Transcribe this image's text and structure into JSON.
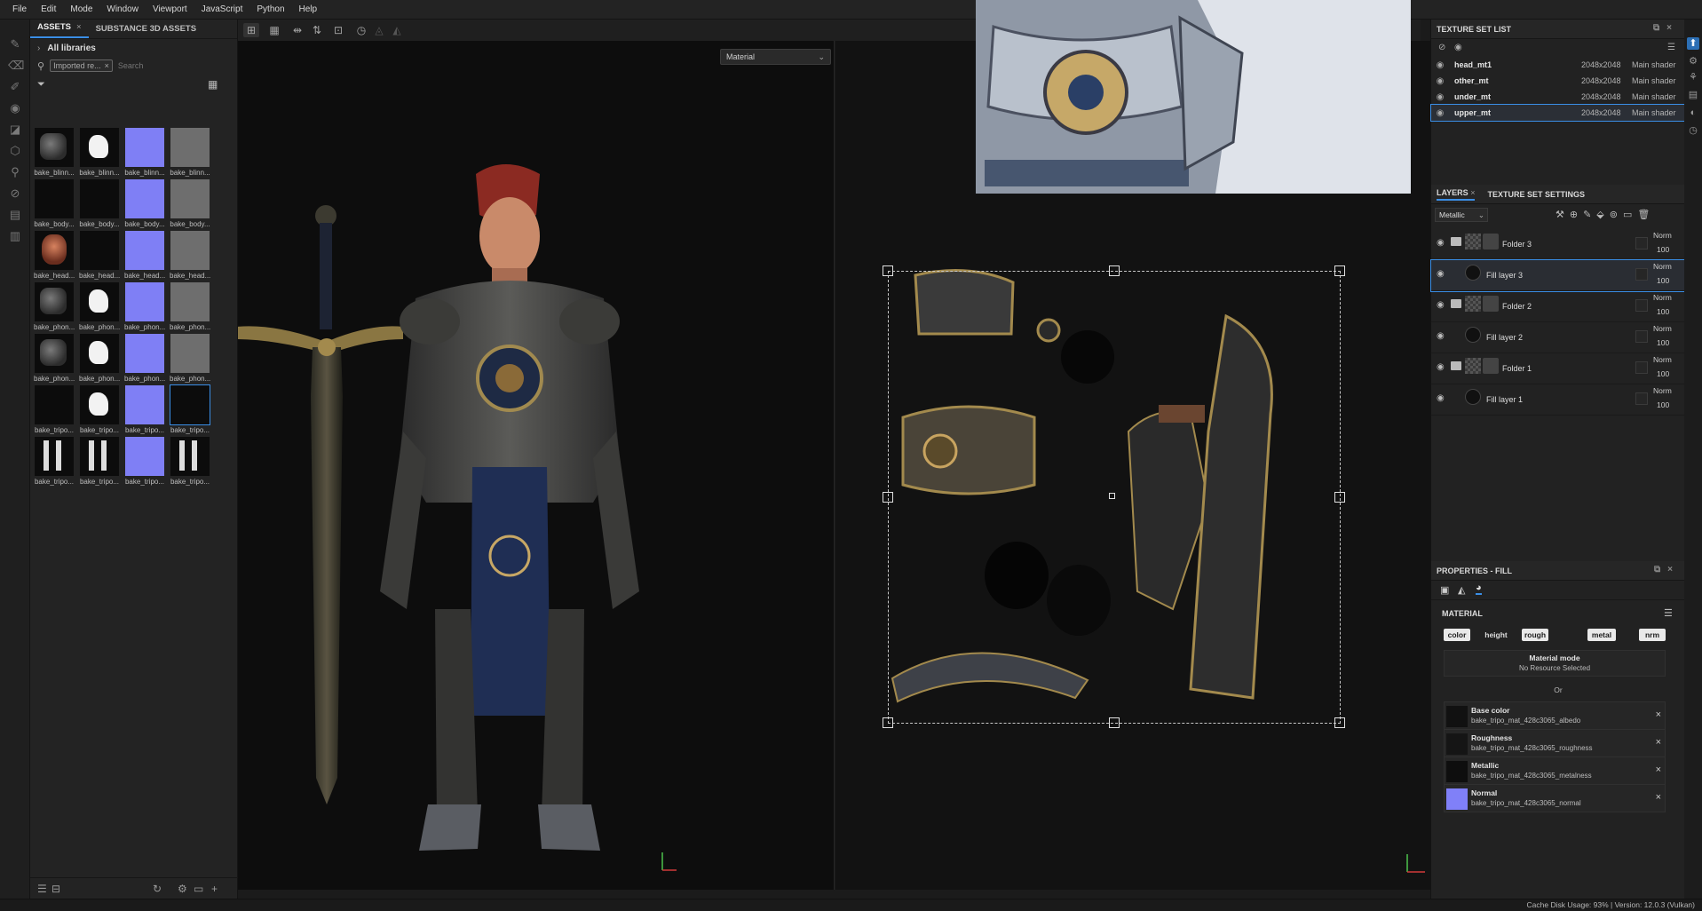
{
  "menu": [
    "File",
    "Edit",
    "Mode",
    "Window",
    "Viewport",
    "JavaScript",
    "Python",
    "Help"
  ],
  "assets": {
    "tabs": [
      "ASSETS",
      "SUBSTANCE 3D ASSETS"
    ],
    "library": "All libraries",
    "filter_chip": "Imported re...",
    "search_placeholder": "Search",
    "thumbnails": [
      {
        "label": "bake_blinn...",
        "kind": "tex"
      },
      {
        "label": "bake_blinn...",
        "kind": "mask"
      },
      {
        "label": "bake_blinn...",
        "kind": "normal"
      },
      {
        "label": "bake_blinn...",
        "kind": "light"
      },
      {
        "label": "bake_body...",
        "kind": "dark"
      },
      {
        "label": "bake_body...",
        "kind": "dark"
      },
      {
        "label": "bake_body...",
        "kind": "normal"
      },
      {
        "label": "bake_body...",
        "kind": "light"
      },
      {
        "label": "bake_head...",
        "kind": "head"
      },
      {
        "label": "bake_head...",
        "kind": "dark"
      },
      {
        "label": "bake_head...",
        "kind": "normal"
      },
      {
        "label": "bake_head...",
        "kind": "light"
      },
      {
        "label": "bake_phon...",
        "kind": "tex"
      },
      {
        "label": "bake_phon...",
        "kind": "mask"
      },
      {
        "label": "bake_phon...",
        "kind": "normal"
      },
      {
        "label": "bake_phon...",
        "kind": "light"
      },
      {
        "label": "bake_phon...",
        "kind": "tex"
      },
      {
        "label": "bake_phon...",
        "kind": "mask"
      },
      {
        "label": "bake_phon...",
        "kind": "normal"
      },
      {
        "label": "bake_phon...",
        "kind": "light"
      },
      {
        "label": "bake_tripo...",
        "kind": "dark"
      },
      {
        "label": "bake_tripo...",
        "kind": "mask"
      },
      {
        "label": "bake_tripo...",
        "kind": "normal"
      },
      {
        "label": "bake_tripo...",
        "kind": "dark"
      },
      {
        "label": "bake_tripo...",
        "kind": "sword"
      },
      {
        "label": "bake_tripo...",
        "kind": "sword"
      },
      {
        "label": "bake_tripo...",
        "kind": "normal"
      },
      {
        "label": "bake_tripo...",
        "kind": "sword"
      }
    ]
  },
  "viewport": {
    "material_mode": "Material"
  },
  "texture_set_list": {
    "title": "TEXTURE SET LIST",
    "rows": [
      {
        "name": "head_mt1",
        "res": "2048x2048",
        "shader": "Main shader"
      },
      {
        "name": "other_mt",
        "res": "2048x2048",
        "shader": "Main shader"
      },
      {
        "name": "under_mt",
        "res": "2048x2048",
        "shader": "Main shader"
      },
      {
        "name": "upper_mt",
        "res": "2048x2048",
        "shader": "Main shader"
      }
    ]
  },
  "layers": {
    "tabs": [
      "LAYERS",
      "TEXTURE SET SETTINGS"
    ],
    "channel": "Metallic",
    "rows": [
      {
        "name": "Folder 3",
        "type": "folder",
        "blend": "Norm",
        "opacity": "100"
      },
      {
        "name": "Fill layer 3",
        "type": "fill",
        "blend": "Norm",
        "opacity": "100"
      },
      {
        "name": "Folder 2",
        "type": "folder",
        "blend": "Norm",
        "opacity": "100"
      },
      {
        "name": "Fill layer 2",
        "type": "fill",
        "blend": "Norm",
        "opacity": "100"
      },
      {
        "name": "Folder 1",
        "type": "folder",
        "blend": "Norm",
        "opacity": "100"
      },
      {
        "name": "Fill layer 1",
        "type": "fill",
        "blend": "Norm",
        "opacity": "100"
      }
    ]
  },
  "properties": {
    "title": "PROPERTIES - FILL",
    "section": "MATERIAL",
    "channels": [
      "color",
      "height",
      "rough",
      "metal",
      "nrm"
    ],
    "material_mode_label": "Material mode",
    "material_mode_value": "No Resource Selected",
    "or_label": "Or",
    "slots": [
      {
        "name": "Base color",
        "file": "bake_tripo_mat_428c3065_albedo",
        "swatch": "#111111"
      },
      {
        "name": "Roughness",
        "file": "bake_tripo_mat_428c3065_roughness",
        "swatch": "#151515"
      },
      {
        "name": "Metallic",
        "file": "bake_tripo_mat_428c3065_metalness",
        "swatch": "#0e0e0e"
      },
      {
        "name": "Normal",
        "file": "bake_tripo_mat_428c3065_normal",
        "swatch": "#8080f8"
      }
    ]
  },
  "status": {
    "text": "Cache Disk Usage:    93% | Version: 12.0.3 (Vulkan)"
  },
  "colors": {
    "accent": "#3a8ee6",
    "panel_bg": "#222222",
    "viewport_bg": "#0d0d0d"
  }
}
